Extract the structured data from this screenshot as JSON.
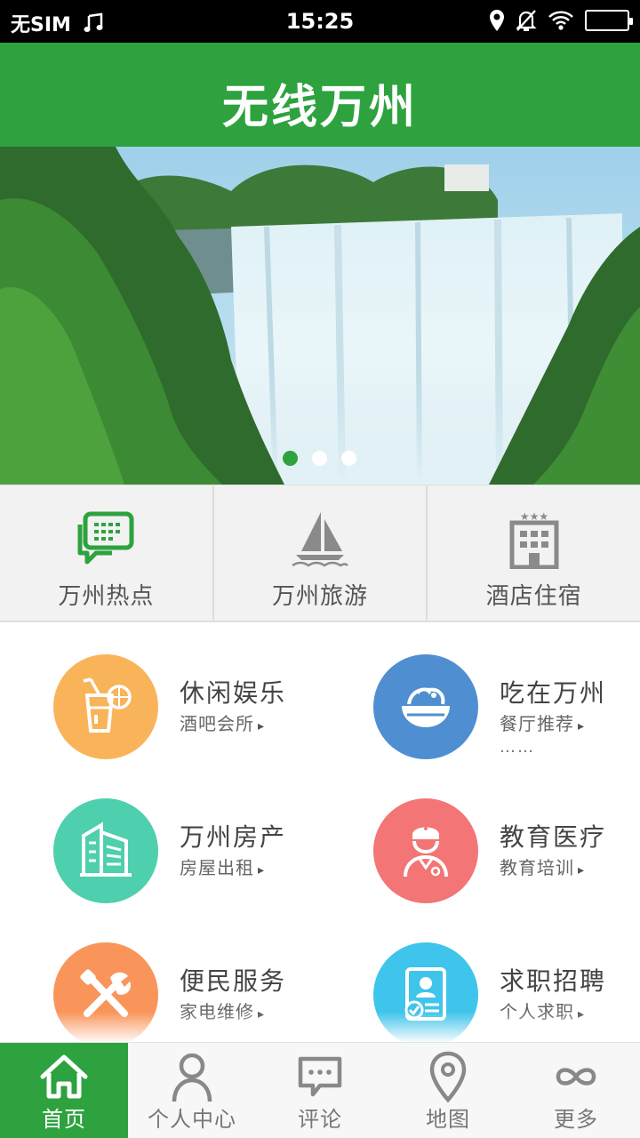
{
  "status_bar": {
    "carrier": "无SIM",
    "time": "15:25",
    "icons": [
      "music-note-icon",
      "location-icon",
      "alarm-off-icon",
      "wifi-icon",
      "battery-icon"
    ]
  },
  "header": {
    "title": "无线万州"
  },
  "banner": {
    "slide_count": 3,
    "active_index": 0,
    "colors": {
      "active_dot": "#2ea23f",
      "inactive_dot": "#ffffff"
    }
  },
  "quick_nav": [
    {
      "label": "万州热点",
      "icon": "chat-bubble-icon"
    },
    {
      "label": "万州旅游",
      "icon": "sailboat-icon"
    },
    {
      "label": "酒店住宿",
      "icon": "hotel-icon"
    }
  ],
  "categories": [
    {
      "title": "休闲娱乐",
      "sub": "酒吧会所",
      "arrow": "▸",
      "icon": "drink-icon",
      "color": "#f9b45a"
    },
    {
      "title": "吃在万州",
      "sub": "餐厅推荐",
      "arrow": "▸",
      "more": "……",
      "icon": "food-bowl-icon",
      "color": "#4f8fd1"
    },
    {
      "title": "万州房产",
      "sub": "房屋出租",
      "arrow": "▸",
      "icon": "building-icon",
      "color": "#4ecfae"
    },
    {
      "title": "教育医疗",
      "sub": "教育培训",
      "arrow": "▸",
      "icon": "nurse-icon",
      "color": "#f37575"
    },
    {
      "title": "便民服务",
      "sub": "家电维修",
      "arrow": "▸",
      "icon": "tools-icon",
      "color": "#f9955a"
    },
    {
      "title": "求职招聘",
      "sub": "个人求职",
      "arrow": "▸",
      "icon": "resume-icon",
      "color": "#3fc4ec"
    }
  ],
  "bottom_nav": [
    {
      "label": "首页",
      "icon": "home-icon",
      "active": true
    },
    {
      "label": "个人中心",
      "icon": "person-icon",
      "active": false
    },
    {
      "label": "评论",
      "icon": "comment-icon",
      "active": false
    },
    {
      "label": "地图",
      "icon": "map-pin-icon",
      "active": false
    },
    {
      "label": "更多",
      "icon": "infinity-icon",
      "active": false
    }
  ],
  "theme": {
    "primary": "#2ea23f"
  }
}
